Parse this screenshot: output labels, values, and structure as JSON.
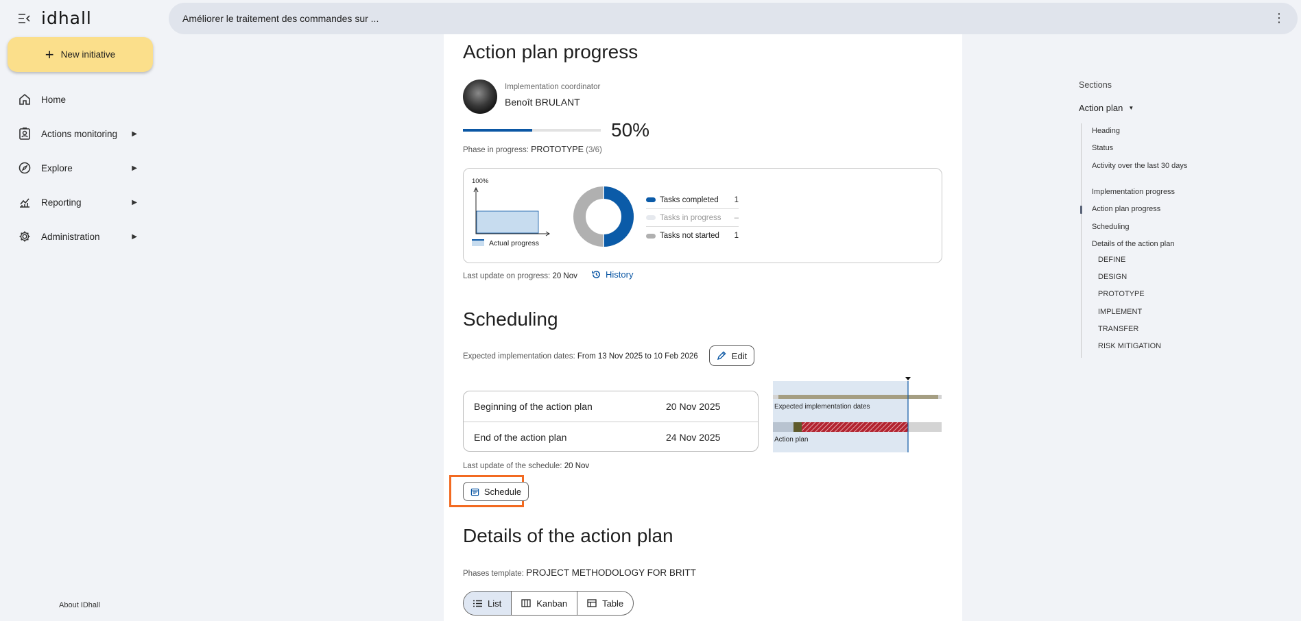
{
  "app": {
    "logo": "idhall",
    "title": "Améliorer le traitement des commandes sur ..."
  },
  "sidebar": {
    "new_initiative": "New initiative",
    "items": [
      {
        "label": "Home",
        "icon": "home-icon",
        "has_submenu": false
      },
      {
        "label": "Actions monitoring",
        "icon": "clipboard-user-icon",
        "has_submenu": true
      },
      {
        "label": "Explore",
        "icon": "compass-icon",
        "has_submenu": true
      },
      {
        "label": "Reporting",
        "icon": "chart-icon",
        "has_submenu": true
      },
      {
        "label": "Administration",
        "icon": "gear-icon",
        "has_submenu": true
      }
    ],
    "about": "About IDhall"
  },
  "action_plan_progress": {
    "title": "Action plan progress",
    "coordinator_label": "Implementation coordinator",
    "coordinator_name": "Benoît BRULANT",
    "progress_fraction": 0.5,
    "progress_text": "50%",
    "phase_label": "Phase in progress:",
    "phase_value": "PROTOTYPE",
    "phase_count": "(3/6)",
    "chart": {
      "y_label": "100%",
      "legend_label": "Actual progress",
      "tasks": [
        {
          "label": "Tasks completed",
          "value": "1",
          "color": "#0b5ba8"
        },
        {
          "label": "Tasks in progress",
          "value": "–",
          "color": "#e6e9ee"
        },
        {
          "label": "Tasks not started",
          "value": "1",
          "color": "#b0b0b0"
        }
      ]
    },
    "last_update_label": "Last update on progress:",
    "last_update_value": "20 Nov",
    "history_label": "History"
  },
  "scheduling": {
    "title": "Scheduling",
    "expected_label": "Expected implementation dates:",
    "expected_value": "From 13 Nov 2025 to 10 Feb 2026",
    "edit_label": "Edit",
    "rows": [
      {
        "label": "Beginning of the action plan",
        "value": "20 Nov 2025"
      },
      {
        "label": "End of the action plan",
        "value": "24 Nov 2025"
      }
    ],
    "gantt": {
      "expected_label": "Expected implementation dates",
      "plan_label": "Action plan"
    },
    "last_update_label": "Last update of the schedule:",
    "last_update_value": "20 Nov",
    "schedule_label": "Schedule"
  },
  "details": {
    "title": "Details of the action plan",
    "template_label": "Phases template:",
    "template_value": "PROJECT METHODOLOGY FOR BRITT",
    "views": [
      "List",
      "Kanban",
      "Table"
    ]
  },
  "sections": {
    "title": "Sections",
    "group": "Action plan",
    "items": [
      "Heading",
      "Status",
      "Activity over the last 30 days",
      "Implementation progress",
      "Action plan progress",
      "Scheduling",
      "Details of the action plan"
    ],
    "sub_items": [
      "DEFINE",
      "DESIGN",
      "PROTOTYPE",
      "IMPLEMENT",
      "TRANSFER",
      "RISK MITIGATION"
    ]
  }
}
